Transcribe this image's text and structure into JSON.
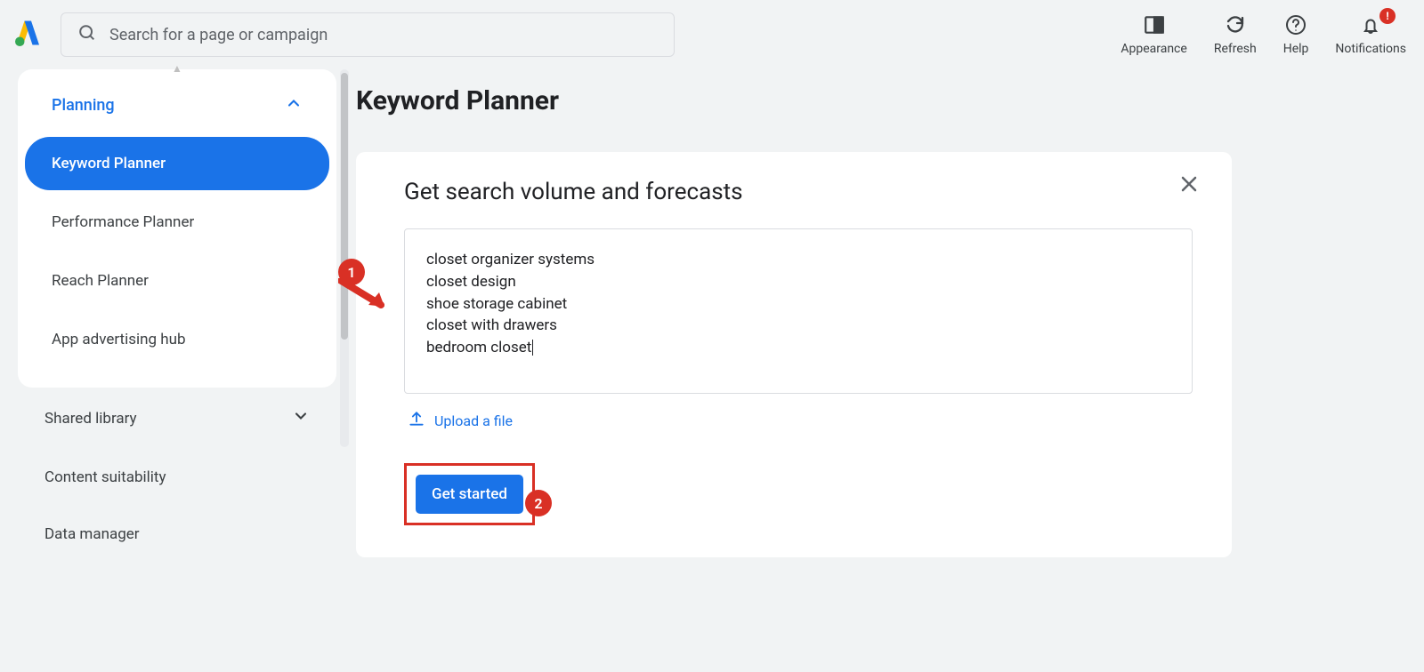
{
  "header": {
    "search_placeholder": "Search for a page or campaign",
    "actions": {
      "appearance": "Appearance",
      "refresh": "Refresh",
      "help": "Help",
      "notifications": "Notifications"
    },
    "notification_alert": "!"
  },
  "sidebar": {
    "planning_label": "Planning",
    "planning_items": [
      "Keyword Planner",
      "Performance Planner",
      "Reach Planner",
      "App advertising hub"
    ],
    "groups": [
      "Shared library",
      "Content suitability",
      "Data manager"
    ]
  },
  "main": {
    "page_title": "Keyword Planner",
    "card_title": "Get search volume and forecasts",
    "keywords_text": "closet organizer systems\ncloset design\nshoe storage cabinet\ncloset with drawers\nbedroom closet",
    "upload_label": "Upload a file",
    "get_started_label": "Get started"
  },
  "annotations": {
    "callout1": "1",
    "callout2": "2"
  }
}
